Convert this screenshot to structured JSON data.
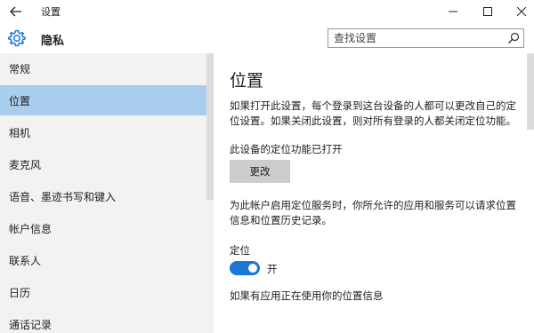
{
  "window": {
    "title": "设置"
  },
  "header": {
    "title": "隐私",
    "search_placeholder": "查找设置"
  },
  "sidebar": {
    "items": [
      {
        "label": "常规",
        "active": false
      },
      {
        "label": "位置",
        "active": true
      },
      {
        "label": "相机",
        "active": false
      },
      {
        "label": "麦克风",
        "active": false
      },
      {
        "label": "语音、墨迹书写和键入",
        "active": false
      },
      {
        "label": "帐户信息",
        "active": false
      },
      {
        "label": "联系人",
        "active": false
      },
      {
        "label": "日历",
        "active": false
      },
      {
        "label": "通话记录",
        "active": false
      }
    ]
  },
  "main": {
    "title": "位置",
    "para1": "如果打开此设置，每个登录到这台设备的人都可以更改自己的定位设置。如果关闭此设置，则对所有登录的人都关闭定位功能。",
    "para2": "此设备的定位功能已打开",
    "change_button": "更改",
    "para3": "为此帐户启用定位服务时，你所允许的应用和服务可以请求位置信息和位置历史记录。",
    "location_label": "定位",
    "location_toggle": {
      "state_label": "开",
      "on": true
    },
    "para4": "如果有应用正在使用你的位置信息"
  },
  "colors": {
    "accent": "#1a78d4",
    "sidebar_bg": "#f2f2f2",
    "active_item": "#a9cdec",
    "button_bg": "#cccccc"
  },
  "icons": {
    "back": "back-arrow-icon",
    "header": "gear-icon",
    "search": "search-icon",
    "minimize": "minimize-icon",
    "maximize": "maximize-icon",
    "close": "close-icon"
  }
}
